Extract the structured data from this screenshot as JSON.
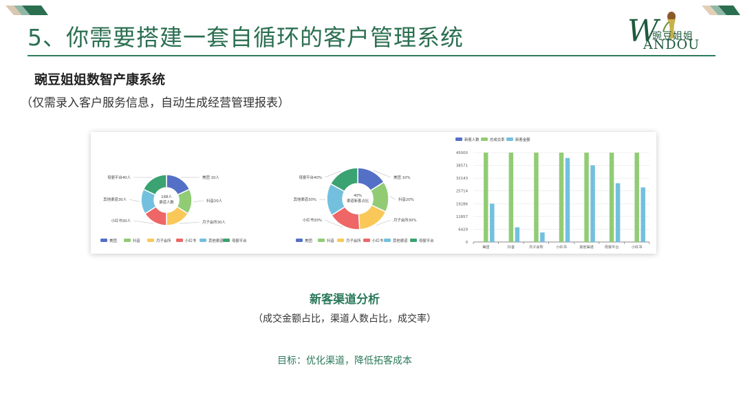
{
  "page": {
    "title": "5、你需要搭建一套自循环的客户管理系统",
    "subtitle": "豌豆姐姐数智产康系统",
    "subnote": "（仅需录入客户服务信息，自动生成经营管理报表）",
    "caption_title": "新客渠道分析",
    "caption_sub": "（成交金额占比，渠道人数占比，成交率）",
    "goal": "目标：优化渠道，降低拓客成本"
  },
  "logo": {
    "cn": "豌豆姐姐",
    "en": "ANDOU",
    "initial": "W"
  },
  "colors": {
    "accent": "#2b7a5a",
    "series": [
      "#5470c6",
      "#91cc75",
      "#fac858",
      "#ee6666",
      "#73c0de",
      "#3ba272"
    ]
  },
  "chart_data": [
    {
      "type": "pie",
      "title": "",
      "center_label": [
        "168人",
        "渠道人数"
      ],
      "categories": [
        "美团",
        "抖音",
        "月子会所",
        "小红书",
        "其他渠道",
        "母婴平台"
      ],
      "values": [
        10,
        20,
        30,
        30,
        30,
        40
      ],
      "slice_weights": [
        18,
        16,
        16,
        16,
        16,
        18
      ],
      "slice_labels": [
        "美团 10人",
        "抖音20人",
        "月子会所30人",
        "小红书30人",
        "其他渠道30人",
        "母婴平台40人"
      ],
      "legend": "bottom"
    },
    {
      "type": "pie",
      "title": "",
      "center_label": [
        "40%",
        "渠道新客占比"
      ],
      "categories": [
        "美团",
        "抖音",
        "月子会所",
        "小红书",
        "其他渠道",
        "母婴平台"
      ],
      "values": [
        10,
        20,
        30,
        30,
        30,
        40
      ],
      "slice_weights": [
        16,
        16,
        17,
        17,
        17,
        17
      ],
      "slice_labels": [
        "美团 10%",
        "抖音20%",
        "月子会所30%",
        "小红书30%",
        "其他渠道30%",
        "母婴平台40%"
      ],
      "legend": "bottom"
    },
    {
      "type": "bar",
      "title": "",
      "categories": [
        "美团",
        "抖音",
        "月子会所",
        "小红书",
        "其他渠道",
        "母婴平台",
        "小红书"
      ],
      "series": [
        {
          "name": "新客人数",
          "values": [
            0,
            0,
            0,
            0,
            0,
            0,
            0
          ]
        },
        {
          "name": "总成交率",
          "values": [
            45000,
            45000,
            45000,
            45000,
            45000,
            45000,
            45000
          ]
        },
        {
          "name": "新客金额",
          "values": [
            19300,
            7400,
            4800,
            42300,
            38600,
            29600,
            27500
          ]
        }
      ],
      "y_ticks": [
        "0",
        "6429",
        "12857",
        "19286",
        "25714",
        "32143",
        "38571",
        "45000"
      ],
      "ylim": [
        0,
        45000
      ],
      "grid": true,
      "legend": "top-left"
    }
  ]
}
